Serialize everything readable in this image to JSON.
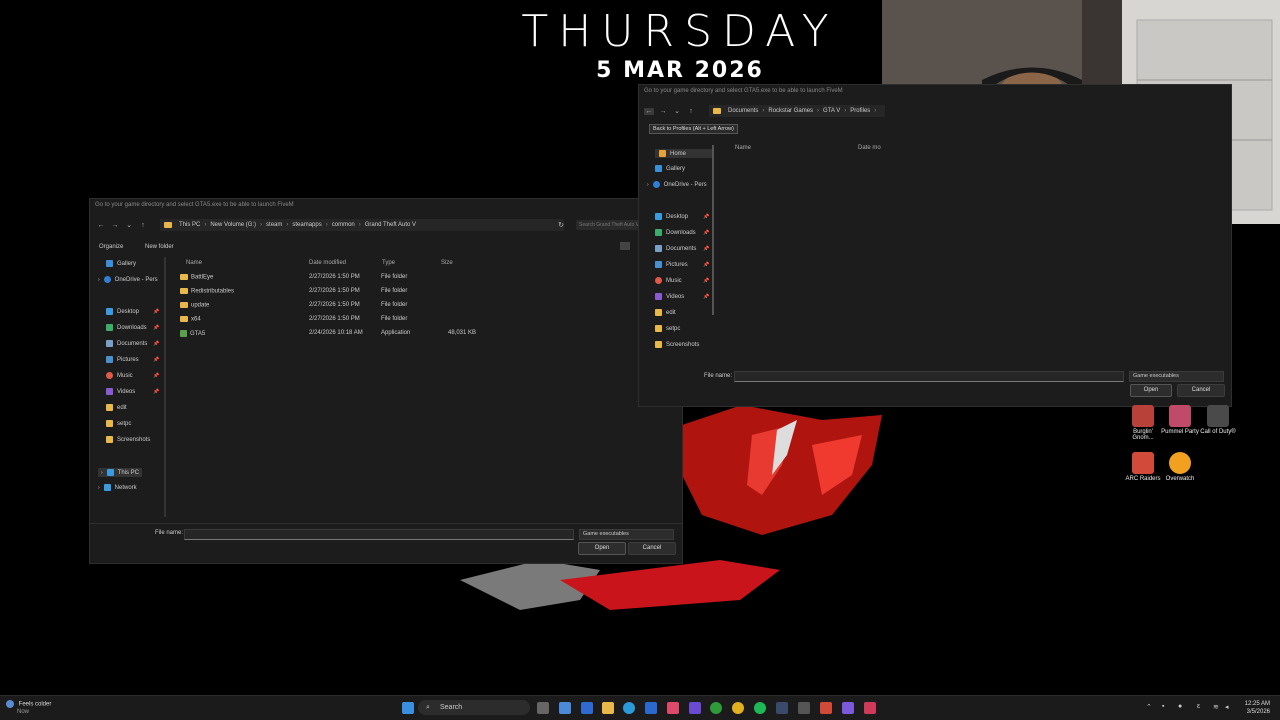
{
  "desktop": {
    "day": "THURSDAY",
    "date": "5 MAR 2026"
  },
  "dialog_left": {
    "title": "Go to your game directory and select GTA5.exe to be able to launch FiveM",
    "breadcrumbs": [
      "This PC",
      "New Volume (G:)",
      "steam",
      "steamapps",
      "common",
      "Grand Theft Auto V"
    ],
    "search_placeholder": "Search Grand Theft Auto V",
    "organize": "Organize",
    "new_folder": "New folder",
    "nav_items": [
      "Gallery",
      "OneDrive - Pers",
      "Desktop",
      "Downloads",
      "Documents",
      "Pictures",
      "Music",
      "Videos",
      "edit",
      "setpc",
      "Screenshots",
      "This PC",
      "Network"
    ],
    "columns": [
      "Name",
      "Date modified",
      "Type",
      "Size"
    ],
    "rows": [
      {
        "name": "BattlEye",
        "date": "2/27/2026 1:50 PM",
        "type": "File folder",
        "size": ""
      },
      {
        "name": "Redistributables",
        "date": "2/27/2026 1:50 PM",
        "type": "File folder",
        "size": ""
      },
      {
        "name": "update",
        "date": "2/27/2026 1:50 PM",
        "type": "File folder",
        "size": ""
      },
      {
        "name": "x64",
        "date": "2/27/2026 1:50 PM",
        "type": "File folder",
        "size": ""
      },
      {
        "name": "GTA5",
        "date": "2/24/2026 10:18 AM",
        "type": "Application",
        "size": "48,031 KB"
      }
    ],
    "file_name_label": "File name:",
    "file_name_value": "",
    "filter": "Game executables",
    "open": "Open",
    "cancel": "Cancel"
  },
  "dialog_right": {
    "title": "Go to your game directory and select GTA5.exe to be able to launch FiveM",
    "breadcrumbs": [
      "Documents",
      "Rockstar Games",
      "GTA V",
      "Profiles"
    ],
    "tooltip": "Back to Profiles (Alt + Left Arrow)",
    "nav_items": [
      "Home",
      "Gallery",
      "OneDrive - Pers",
      "Desktop",
      "Downloads",
      "Documents",
      "Pictures",
      "Music",
      "Videos",
      "edit",
      "setpc",
      "Screenshots"
    ],
    "columns": [
      "Name",
      "Date mo"
    ],
    "file_name_label": "File name:",
    "file_name_value": "",
    "filter": "Game executables",
    "open": "Open",
    "cancel": "Cancel"
  },
  "desktop_icons": [
    {
      "label": "Burglin' Gnom...",
      "color": "#b8423a"
    },
    {
      "label": "Pummel Party",
      "color": "#c04a6a"
    },
    {
      "label": "Call of Duty®",
      "color": "#4a4a4a"
    },
    {
      "label": "ARC Raiders",
      "color": "#d24a3a"
    },
    {
      "label": "Overwatch",
      "color": "#f2a020"
    }
  ],
  "taskbar": {
    "weather_line1": "Feels colder",
    "weather_line2": "Now",
    "search": "Search",
    "time": "12:25 AM",
    "date": "3/5/2026"
  },
  "colors": {
    "taskbar": "#1b1b1b",
    "dialog": "#1c1c1c",
    "folder": "#e8b84a",
    "accent_red": "#e0201c"
  }
}
